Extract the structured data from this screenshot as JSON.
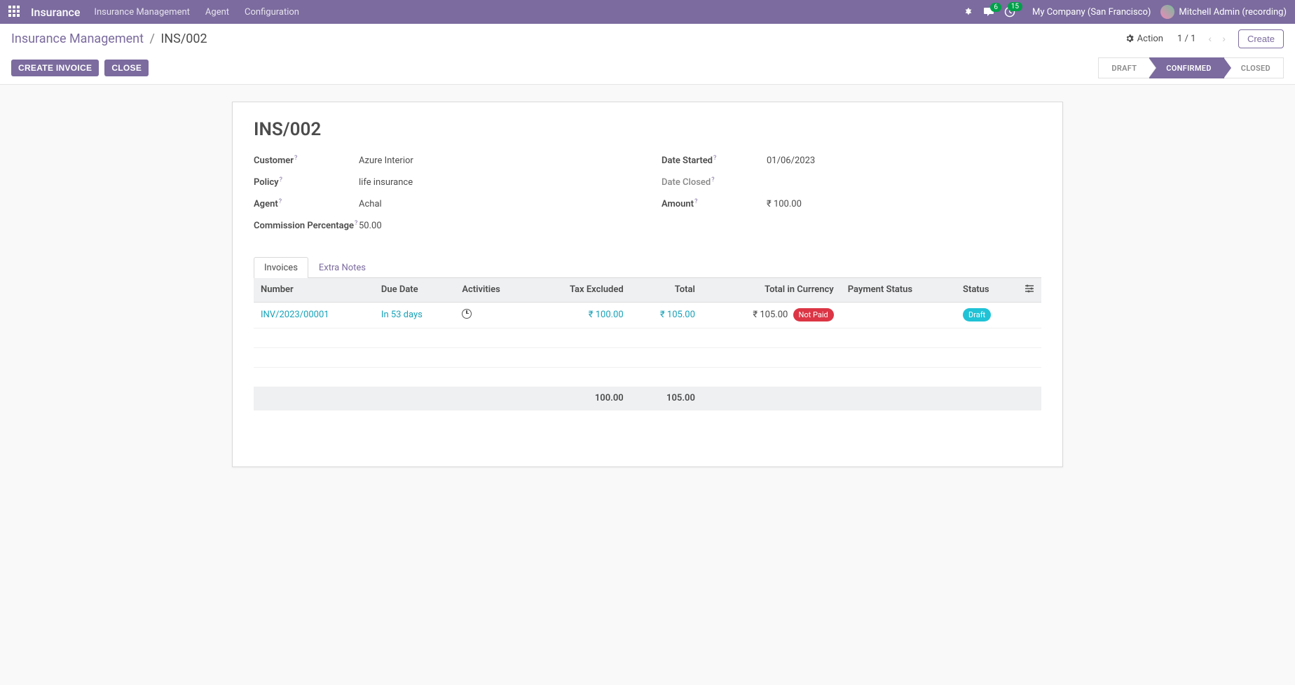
{
  "navbar": {
    "brand": "Insurance",
    "links": [
      "Insurance Management",
      "Agent",
      "Configuration"
    ],
    "chat_badge": "6",
    "clock_badge": "15",
    "company": "My Company (San Francisco)",
    "user": "Mitchell Admin (recording)"
  },
  "breadcrumb": {
    "parent": "Insurance Management",
    "current": "INS/002"
  },
  "toolbar": {
    "action_label": "Action",
    "pager": "1 / 1",
    "create_label": "Create",
    "create_invoice": "CREATE INVOICE",
    "close": "CLOSE"
  },
  "status": {
    "steps": [
      "DRAFT",
      "CONFIRMED",
      "CLOSED"
    ],
    "active": "CONFIRMED"
  },
  "record": {
    "name": "INS/002",
    "fields_left": [
      {
        "label": "Customer",
        "value": "Azure Interior",
        "help": true
      },
      {
        "label": "Policy",
        "value": "life insurance",
        "help": true
      },
      {
        "label": "Agent",
        "value": "Achal",
        "help": true
      },
      {
        "label": "Commission Percentage",
        "value": "50.00",
        "help": true
      }
    ],
    "fields_right": [
      {
        "label": "Date Started",
        "value": "01/06/2023",
        "help": true
      },
      {
        "label": "Date Closed",
        "value": "",
        "help": true,
        "dim": true
      },
      {
        "label": "Amount",
        "value": "₹ 100.00",
        "help": true
      }
    ]
  },
  "tabs": {
    "active": 0,
    "headers": [
      "Invoices",
      "Extra Notes"
    ]
  },
  "table": {
    "columns": [
      "Number",
      "Due Date",
      "Activities",
      "Tax Excluded",
      "Total",
      "Total in Currency",
      "Payment Status",
      "Status"
    ],
    "row": {
      "number": "INV/2023/00001",
      "due": "In 53 days",
      "tax_excluded": "₹ 100.00",
      "total": "₹ 105.00",
      "total_currency": "₹ 105.00",
      "payment_status": "Not Paid",
      "status": "Draft"
    },
    "totals": {
      "tax_excluded": "100.00",
      "total": "105.00"
    }
  }
}
